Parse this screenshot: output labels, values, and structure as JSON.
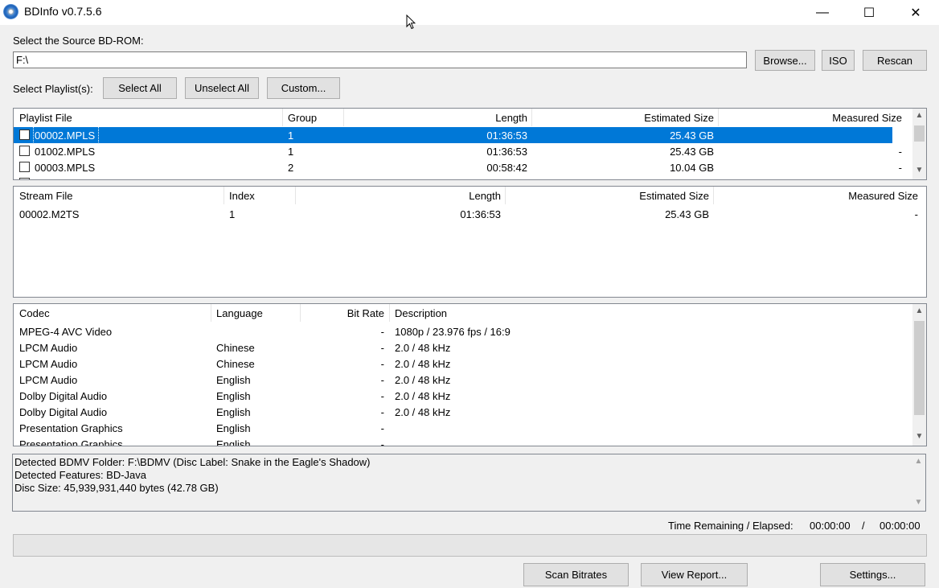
{
  "window": {
    "title": "BDInfo v0.7.5.6",
    "minimize_glyph": "—",
    "maximize_glyph": "☐",
    "close_glyph": "✕"
  },
  "source": {
    "label": "Select the Source BD-ROM:",
    "path": "F:\\",
    "browse_label": "Browse...",
    "iso_label": "ISO",
    "rescan_label": "Rescan"
  },
  "playlist_select": {
    "label": "Select Playlist(s):",
    "select_all": "Select All",
    "unselect_all": "Unselect All",
    "custom": "Custom..."
  },
  "playlists": {
    "headers": [
      "Playlist File",
      "Group",
      "Length",
      "Estimated Size",
      "Measured Size"
    ],
    "rows": [
      {
        "file": "00002.MPLS",
        "group": "1",
        "length": "01:36:53",
        "est": "25.43 GB",
        "meas": "-",
        "checked": false,
        "selected": true
      },
      {
        "file": "01002.MPLS",
        "group": "1",
        "length": "01:36:53",
        "est": "25.43 GB",
        "meas": "-",
        "checked": false,
        "selected": false
      },
      {
        "file": "00003.MPLS",
        "group": "2",
        "length": "00:58:42",
        "est": "10.04 GB",
        "meas": "-",
        "checked": false,
        "selected": false
      }
    ]
  },
  "streams": {
    "headers": [
      "Stream File",
      "Index",
      "Length",
      "Estimated Size",
      "Measured Size"
    ],
    "rows": [
      {
        "file": "00002.M2TS",
        "index": "1",
        "length": "01:36:53",
        "est": "25.43 GB",
        "meas": "-"
      }
    ]
  },
  "codecs": {
    "headers": [
      "Codec",
      "Language",
      "Bit Rate",
      "Description"
    ],
    "rows": [
      {
        "codec": "MPEG-4 AVC Video",
        "lang": "",
        "rate": "-",
        "desc": "1080p / 23.976 fps / 16:9"
      },
      {
        "codec": "LPCM Audio",
        "lang": "Chinese",
        "rate": "-",
        "desc": "2.0 / 48 kHz"
      },
      {
        "codec": "LPCM Audio",
        "lang": "Chinese",
        "rate": "-",
        "desc": "2.0 / 48 kHz"
      },
      {
        "codec": "LPCM Audio",
        "lang": "English",
        "rate": "-",
        "desc": "2.0 / 48 kHz"
      },
      {
        "codec": "Dolby Digital Audio",
        "lang": "English",
        "rate": "-",
        "desc": "2.0 / 48 kHz"
      },
      {
        "codec": "Dolby Digital Audio",
        "lang": "English",
        "rate": "-",
        "desc": "2.0 / 48 kHz"
      },
      {
        "codec": "Presentation Graphics",
        "lang": "English",
        "rate": "-",
        "desc": ""
      },
      {
        "codec": "Presentation Graphics",
        "lang": "English",
        "rate": "-",
        "desc": ""
      }
    ]
  },
  "info": {
    "lines": [
      "Detected BDMV Folder: F:\\BDMV (Disc Label: Snake in the Eagle's Shadow)",
      "Detected Features: BD-Java",
      "Disc Size: 45,939,931,440 bytes (42.78 GB)"
    ]
  },
  "timing": {
    "label": "Time Remaining / Elapsed:",
    "remaining": "00:00:00",
    "separator": "/",
    "elapsed": "00:00:00"
  },
  "progress": {
    "value": 0
  },
  "bottom": {
    "scan_bitrates": "Scan Bitrates",
    "view_report": "View Report...",
    "settings": "Settings..."
  },
  "icons": {
    "app": "disc-icon",
    "up": "▲",
    "down": "▼"
  },
  "colors": {
    "selection": "#0078d7"
  }
}
